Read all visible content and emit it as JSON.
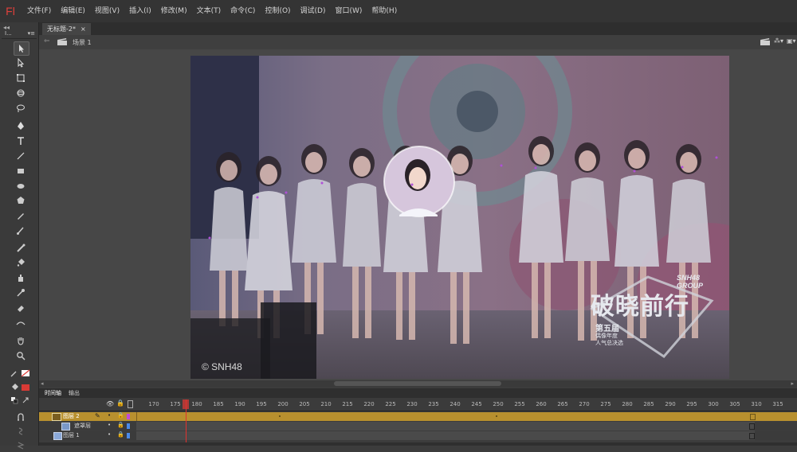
{
  "app": {
    "logo": "Fl"
  },
  "menu": [
    "文件(F)",
    "编辑(E)",
    "视图(V)",
    "插入(I)",
    "修改(M)",
    "文本(T)",
    "命令(C)",
    "控制(O)",
    "调试(D)",
    "窗口(W)",
    "帮助(H)"
  ],
  "toolbar": {
    "workspace_label": "I...",
    "collapse": "◂◂"
  },
  "document": {
    "tab_title": "无标题-2*",
    "tab_close": "×",
    "scene": "场景 1"
  },
  "stage": {
    "watermark": "© SNH48",
    "logo_title": "破晓前行",
    "logo_group": "SNH48 GROUP",
    "logo_sub1": "第五届",
    "logo_sub2": "偶像年度",
    "logo_sub3": "人气总决选"
  },
  "timeline": {
    "tabs": [
      "时间轴",
      "输出"
    ],
    "ticks": [
      "170",
      "175",
      "180",
      "185",
      "190",
      "195",
      "200",
      "205",
      "210",
      "215",
      "220",
      "225",
      "230",
      "235",
      "240",
      "245",
      "250",
      "255",
      "260",
      "265",
      "270",
      "275",
      "280",
      "285",
      "290",
      "295",
      "300",
      "305",
      "310",
      "315"
    ],
    "current_frame": 180,
    "layers": [
      {
        "name": "图层 2",
        "selected": true
      },
      {
        "name": "遮罩层",
        "selected": false
      },
      {
        "name": "图层 1",
        "selected": false
      }
    ]
  },
  "colors": {
    "accent_red": "#e0403b",
    "selected_layer": "#b8902e",
    "playhead": "#e0322e"
  }
}
